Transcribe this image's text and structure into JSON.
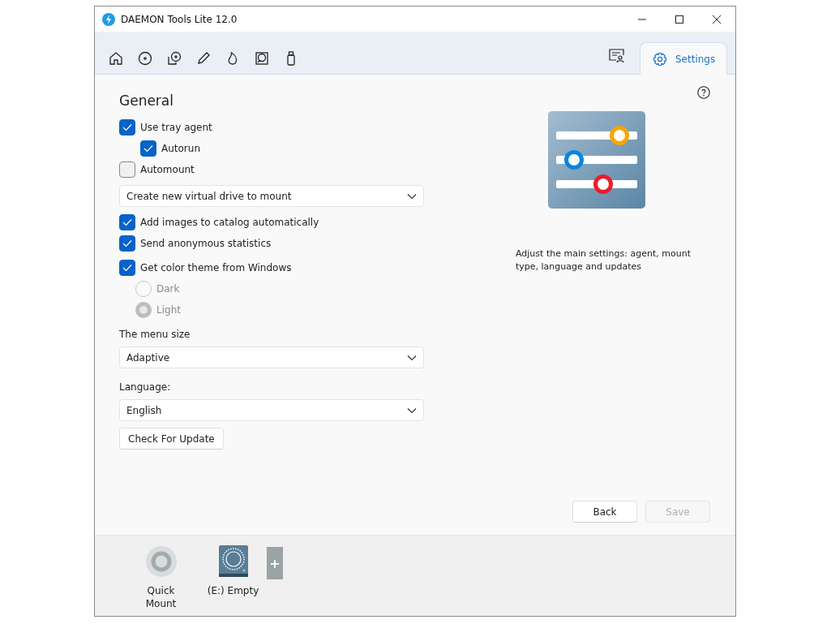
{
  "window": {
    "title": "DAEMON Tools Lite 12.0"
  },
  "tabs": [
    {
      "label": "Settings",
      "selected": true
    }
  ],
  "settings": {
    "heading": "General",
    "groups": [
      [
        {
          "kind": "checkbox",
          "label": "Use tray agent",
          "checked": true,
          "children": [
            {
              "kind": "checkbox",
              "label": "Autorun",
              "checked": true
            }
          ]
        },
        {
          "kind": "checkbox",
          "label": "Automount",
          "checked": false
        },
        {
          "kind": "select",
          "value": "Create new virtual drive to mount"
        },
        {
          "kind": "checkbox",
          "label": "Add images to catalog automatically",
          "checked": true
        },
        {
          "kind": "checkbox",
          "label": "Send anonymous statistics",
          "checked": true
        }
      ],
      [
        {
          "kind": "checkbox",
          "label": "Get color theme from Windows",
          "checked": true,
          "children": [
            {
              "kind": "radio",
              "label": "Dark",
              "selected": false,
              "disabled": true
            },
            {
              "kind": "radio",
              "label": "Light",
              "selected": true,
              "disabled": true
            }
          ]
        }
      ],
      [
        {
          "kind": "label",
          "text": "The menu size"
        },
        {
          "kind": "select",
          "value": "Adaptive"
        }
      ],
      [
        {
          "kind": "label",
          "text": "Language:"
        },
        {
          "kind": "select",
          "value": "English"
        },
        {
          "kind": "button",
          "label": "Check For Update"
        }
      ]
    ],
    "description": "Adjust the main settings: agent, mount type, language and updates",
    "buttons": [
      {
        "label": "Back",
        "disabled": false
      },
      {
        "label": "Save",
        "disabled": true
      }
    ]
  },
  "dock": {
    "items": [
      {
        "kind": "quick-mount",
        "label": "Quick Mount"
      },
      {
        "kind": "drive",
        "label": "(E:) Empty"
      },
      {
        "kind": "add",
        "label": "+"
      }
    ]
  }
}
